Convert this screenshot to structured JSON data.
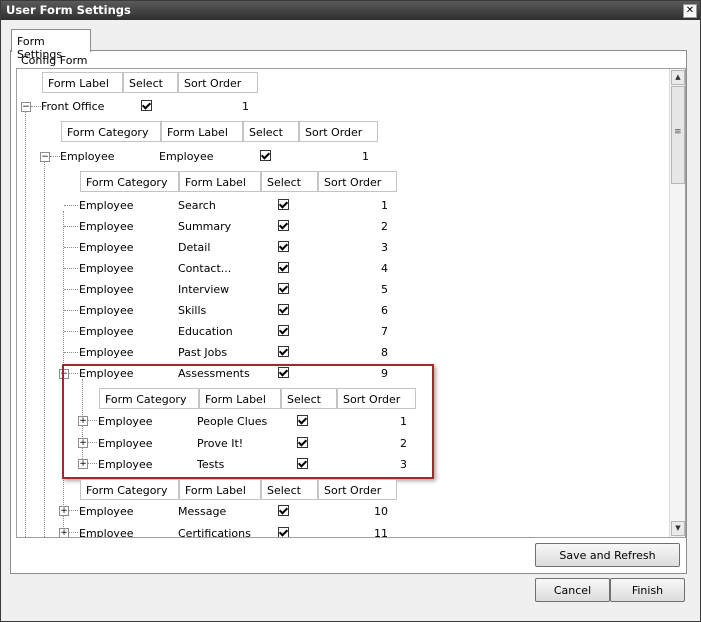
{
  "window": {
    "title": "User Form Settings",
    "close": "✕"
  },
  "tab": {
    "label": "Form Settings"
  },
  "group": {
    "label": "Config Form"
  },
  "top_header": [
    "Form Label",
    "Select",
    "Sort Order"
  ],
  "front_office": {
    "label": "Front Office",
    "sort": "1",
    "checked": true
  },
  "header2": [
    "Form Category",
    "Form Label",
    "Select",
    "Sort Order"
  ],
  "employee_group": {
    "category": "Employee",
    "label": "Employee",
    "sort": "1"
  },
  "header3": [
    "Form Category",
    "Form Label",
    "Select",
    "Sort Order"
  ],
  "rows": [
    {
      "category": "Employee",
      "label": "Search",
      "sort": "1"
    },
    {
      "category": "Employee",
      "label": "Summary",
      "sort": "2"
    },
    {
      "category": "Employee",
      "label": "Detail",
      "sort": "3"
    },
    {
      "category": "Employee",
      "label": "Contact...",
      "sort": "4"
    },
    {
      "category": "Employee",
      "label": "Interview",
      "sort": "5"
    },
    {
      "category": "Employee",
      "label": "Skills",
      "sort": "6"
    },
    {
      "category": "Employee",
      "label": "Education",
      "sort": "7"
    },
    {
      "category": "Employee",
      "label": "Past Jobs",
      "sort": "8"
    }
  ],
  "assessments": {
    "category": "Employee",
    "label": "Assessments",
    "sort": "9"
  },
  "header4": [
    "Form Category",
    "Form Label",
    "Select",
    "Sort Order"
  ],
  "sub_rows": [
    {
      "category": "Employee",
      "label": "People Clues",
      "sort": "1"
    },
    {
      "category": "Employee",
      "label": "Prove It!",
      "sort": "2"
    },
    {
      "category": "Employee",
      "label": "Tests",
      "sort": "3"
    }
  ],
  "header5": [
    "Form Category",
    "Form Label",
    "Select",
    "Sort Order"
  ],
  "after_rows": [
    {
      "category": "Employee",
      "label": "Message",
      "sort": "10"
    },
    {
      "category": "Employee",
      "label": "Certifications",
      "sort": "11"
    }
  ],
  "buttons": {
    "save_refresh": "Save and Refresh",
    "cancel": "Cancel",
    "finish": "Finish"
  },
  "colors": {
    "highlight": "#a02a2a",
    "titlebar": "#3a3a3a"
  }
}
